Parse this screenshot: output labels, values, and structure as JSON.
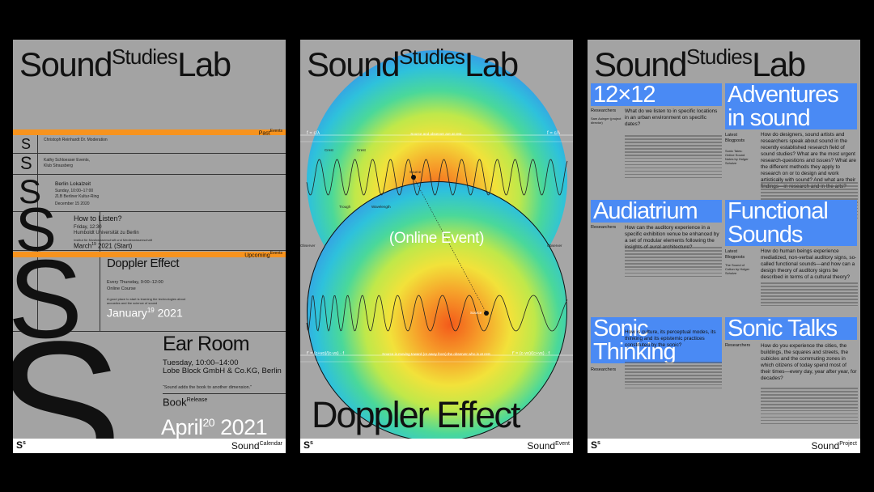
{
  "brand": {
    "sound": "Sound",
    "studies": "Studies",
    "lab": "Lab"
  },
  "poster1": {
    "past_label": "Past",
    "past_sup": "Events",
    "event_a_small": "Christoph Reinhardt Dr. Moderation",
    "event_b_small": "Kathy Schloesser Events, Klub Strausberg",
    "berlin_lokalzeit": "Berlin Lokalzeit",
    "berlin_lines": "Sunday, 10:00–17:00",
    "berlin_line2": "ZLB Berliner Kultur-Ring",
    "berlin_date": "December 15 2020",
    "how_title": "How to Listen?",
    "how_time": "Friday, 12:30",
    "how_place": "Humboldt Universität zu Berlin",
    "how_small": "Institut für Musikwissenschaft und Medienwissenschaft",
    "how_date": "March",
    "how_date_sup": "19",
    "how_date_tail": "2021 (Start)",
    "upcoming_label": "Upcoming",
    "upcoming_sup": "Events",
    "doppler_title": "Doppler Effect",
    "doppler_time": "Every Thursday, 9:00–12:00",
    "doppler_place": "Online Course",
    "doppler_desc": "A good place to start is learning the technologies about acoustics and the science of sound",
    "doppler_date": "January",
    "doppler_date_sup": "19",
    "doppler_date_tail": "2021",
    "ear_title": "Ear Room",
    "ear_time": "Tuesday, 10:00–14:00",
    "ear_place": "Lobe Block GmbH & Co.KG, Berlin",
    "ear_quote": "“Sound adds the book to another dimension.”",
    "book_label": "Book",
    "book_sup": "Release",
    "book_date": "April",
    "book_date_sup": "20",
    "book_date_tail": "2021",
    "s_letter": "S",
    "footer_ss": "S",
    "footer_ss_sup": "s",
    "footer_title": "Sound",
    "footer_sup": "Calendar"
  },
  "poster2": {
    "caption_top": "Source and observer are at rest.",
    "caption_bottom": "Source is moving toward (or away from) the observer who is at rest.",
    "formula_top_left": "f = c/λ",
    "formula_top_right": "f = c/λ",
    "formula_bottom_left": "f' = (c+vo)/(c-vs) · f",
    "formula_bottom_right": "f' = (c-vo)/(c+vs) · f",
    "label_crest": "Crest",
    "label_crest2": "Crest",
    "label_trough": "Trough",
    "label_wavelength": "Wavelength",
    "label_source": "Source",
    "label_observer": "Observer",
    "label_observer2": "Observer",
    "label_source2": "Source",
    "online": "(Online Event)",
    "title": "Doppler Effect",
    "footer_ss": "S",
    "footer_ss_sup": "s",
    "footer_title": "Sound",
    "footer_sup": "Event"
  },
  "poster3": {
    "t12": "12×12",
    "adventures": "Adventures in sound",
    "audiatrium": "Audiatrium",
    "functional": "Functional Sounds",
    "sonic_thinking": "Sonic Thinking",
    "sonic_talks": "Sonic Talks",
    "q1": "What do we listen to in specific locations in an urban environment on specific dates?",
    "q2": "How do designers, sound artists and researchers speak about sound in the recently established research field of sound studies? What are the most urgent research-questions and issues? What are the different methods they apply to research on or to design and work artistically with sound? And what are their findings—in research and in the arts?",
    "q3": "How can the auditory experience in a specific exhibition venue be enhanced by a set of modular elements following the insights of aural architecture?",
    "q4": "How do human beings experience mediatized, non-verbal auditory signs, so-called functional sounds—and how can a design theory of auditory signs be described in terms of a cultural theory?",
    "q5": "How is culture, its perceptual modes, its thinking and its epistemic practices constituted by the sonic?",
    "q6": "How do you experience the cities, the buildings, the squares and streets, the cubicles and the commuting zones in which citizens of today spend most of their times—every day, year after year, for decades?",
    "label_researchers": "Researchers",
    "label_latest": "Latest Blogposts",
    "researchers1": "Sam Auinger (project director)",
    "blog1": "Sonic Tales: Online Sound Notes by Holger Schulze",
    "blog2": "The Sound of Cotton by Holger Schulze",
    "footer_ss": "S",
    "footer_ss_sup": "s",
    "footer_title": "Sound",
    "footer_sup": "Project"
  },
  "colors": {
    "accent_orange": "#f7931e",
    "accent_blue": "#4a8af4",
    "poster_gray": "#a3a3a3",
    "background": "#000000"
  }
}
